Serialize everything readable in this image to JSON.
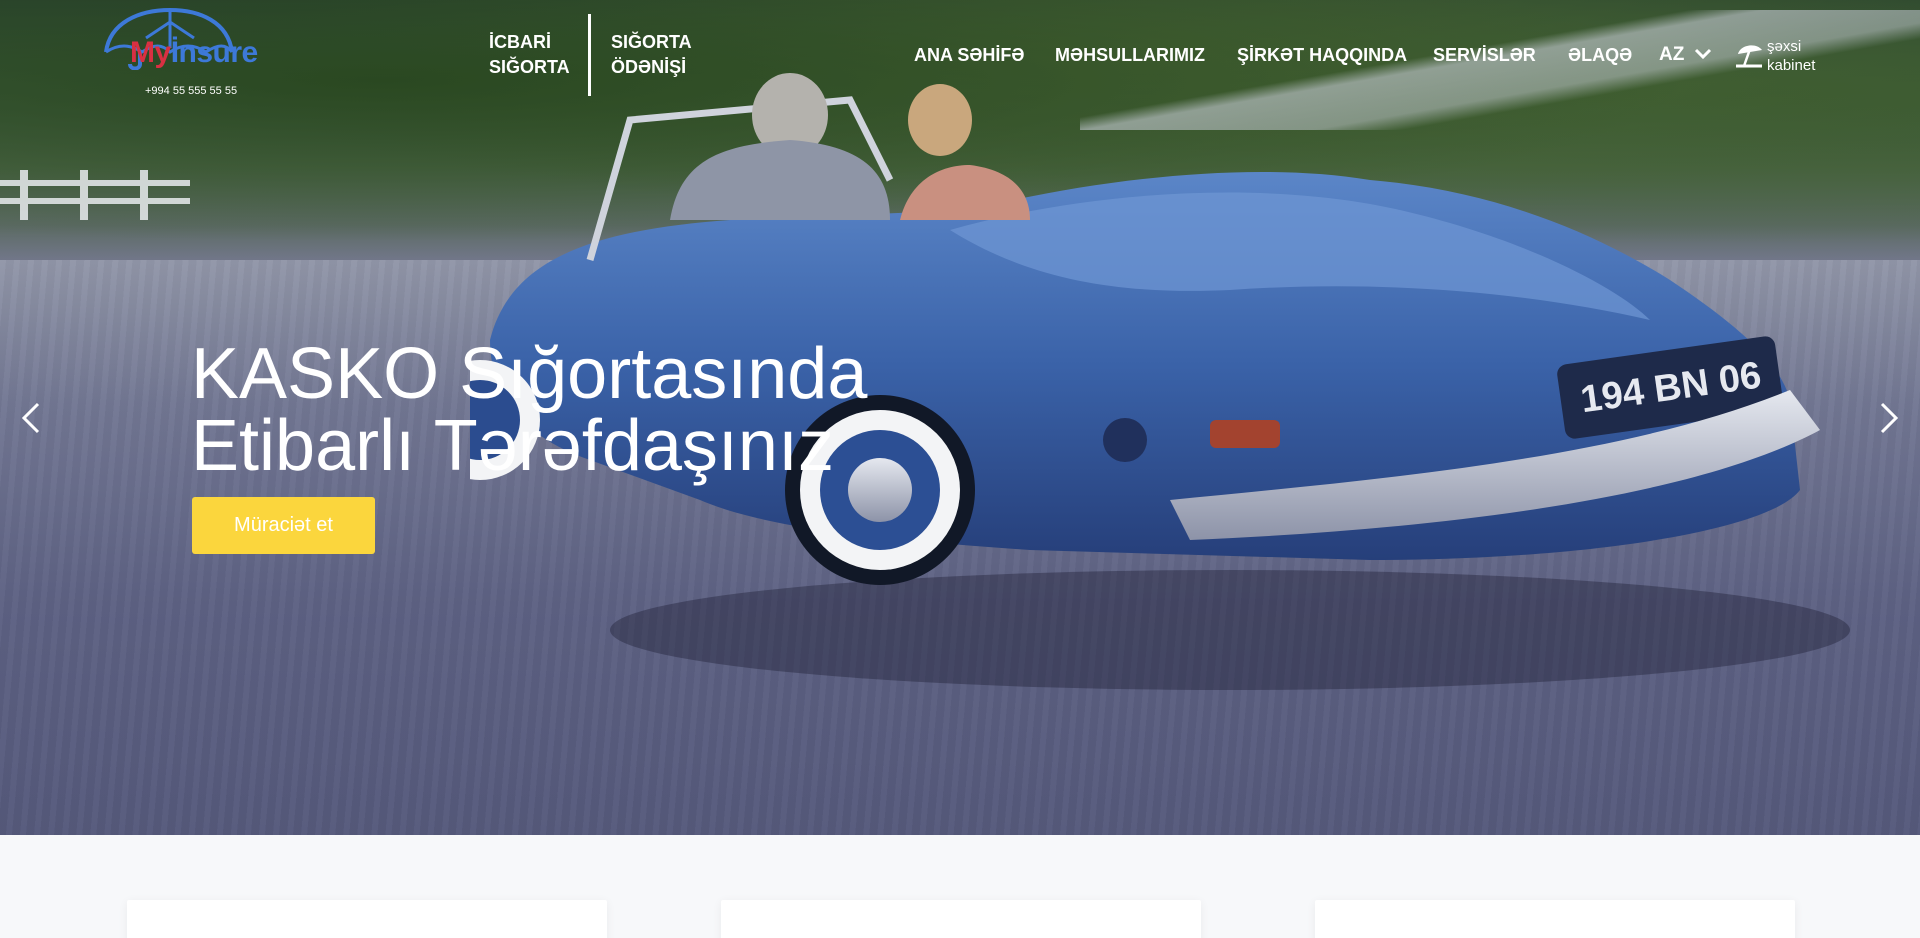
{
  "header": {
    "logo_text_part1": "My",
    "logo_text_part2": "İnsure",
    "phone": "+994 55 555 55 55",
    "split_nav": [
      {
        "line1": "İCBARİ",
        "line2": "SIĞORTA"
      },
      {
        "line1": "SIĞORTA",
        "line2": "ÖDƏNİŞİ"
      }
    ],
    "nav": [
      "ANA SƏHİFƏ",
      "MƏHSULLARIMIZ",
      "ŞİRKƏT HAQQINDA",
      "SERVİSLƏR",
      "ƏLAQƏ"
    ],
    "language": "AZ",
    "cabinet_line1": "şəxsi",
    "cabinet_line2": "kabinet"
  },
  "hero": {
    "title_line1": "KASKO Sığortasında",
    "title_line2": "Etibarlı Tərəfdaşınız",
    "cta_label": "Müraciət et",
    "license_plate": "194 BN 06"
  },
  "colors": {
    "accent_yellow": "#fbd63d",
    "brand_red": "#d93042",
    "brand_blue": "#3d79d8"
  },
  "icons": {
    "logo": "umbrella-logo-icon",
    "language_dropdown": "chevron-down-icon",
    "cabinet": "umbrella-user-icon",
    "prev": "chevron-left-icon",
    "next": "chevron-right-icon"
  }
}
